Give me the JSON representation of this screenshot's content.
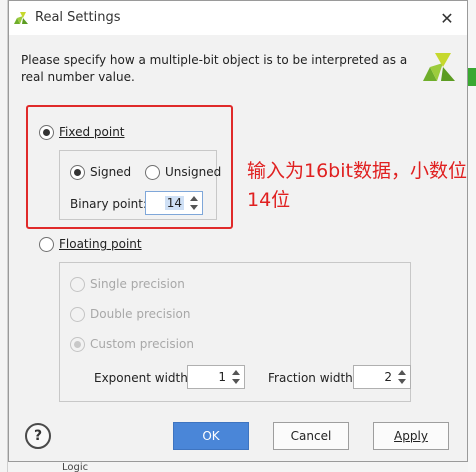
{
  "window": {
    "title": "Real Settings"
  },
  "description": "Please specify how a multiple-bit object is to be interpreted as a real number value.",
  "fixed_point": {
    "label": "Fixed point",
    "selected": true,
    "signed_label": "Signed",
    "unsigned_label": "Unsigned",
    "signed_selected": true,
    "binary_point_label": "Binary point:",
    "binary_point_value": "14"
  },
  "floating_point": {
    "label": "Floating point",
    "selected": false,
    "single_label": "Single precision",
    "double_label": "Double precision",
    "custom_label": "Custom precision",
    "exponent_label": "Exponent width:",
    "exponent_value": "1",
    "fraction_label": "Fraction width:",
    "fraction_value": "2"
  },
  "annotation": "输入为16bit数据，小数位14位",
  "buttons": {
    "help": "?",
    "ok": "OK",
    "cancel": "Cancel",
    "apply": "Apply"
  },
  "background": {
    "bottom_text": "Logic"
  },
  "colors": {
    "annotation": "#e02020",
    "primary_button": "#4a86d8",
    "logo_green": "#8dc63f"
  }
}
